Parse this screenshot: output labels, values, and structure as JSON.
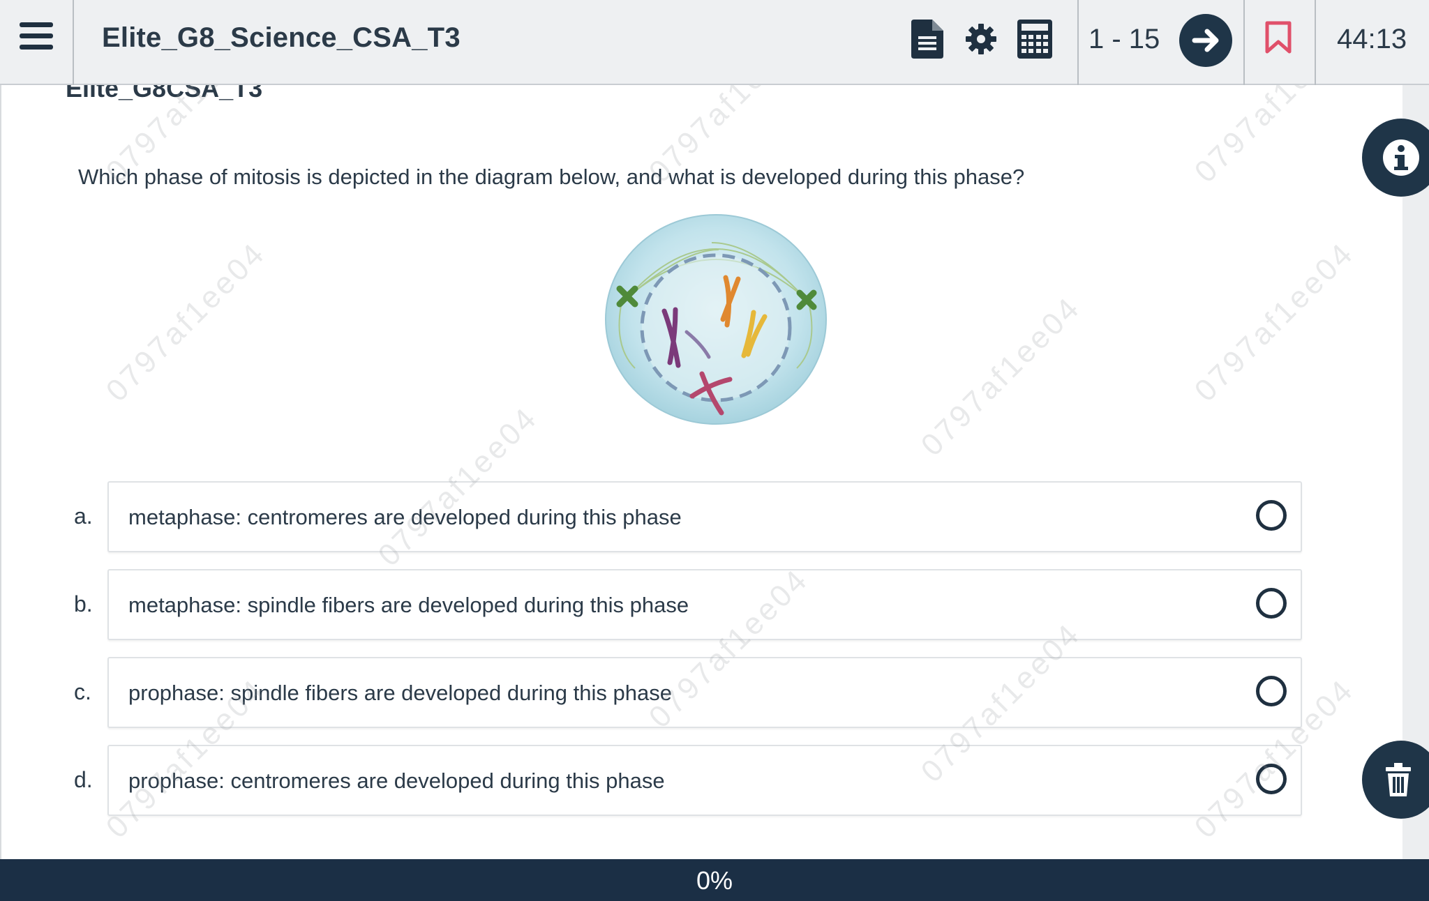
{
  "header": {
    "title": "Elite_G8_Science_CSA_T3",
    "question_range": "1 - 15",
    "timer": "44:13"
  },
  "content": {
    "sub_title": "Elite_G8CSA_T3",
    "question": "Which phase of mitosis is depicted in the diagram below, and what is developed during this phase?",
    "choices": [
      {
        "letter": "a.",
        "text": "metaphase: centromeres are developed during this phase"
      },
      {
        "letter": "b.",
        "text": "metaphase: spindle fibers are developed during this phase"
      },
      {
        "letter": "c.",
        "text": "prophase: spindle fibers are developed during this phase"
      },
      {
        "letter": "d.",
        "text": "prophase: centromeres are developed during this phase"
      }
    ]
  },
  "watermark": "0797af1ee04",
  "progress": {
    "label": "0%",
    "value": 0
  },
  "icons": {
    "menu": "hamburger-menu-icon",
    "document": "document-icon",
    "settings": "gear-icon",
    "calculator": "calculator-icon",
    "next": "arrow-right-icon",
    "bookmark": "bookmark-icon",
    "info": "info-icon",
    "delete": "trash-icon"
  },
  "colors": {
    "accent": "#1f3548",
    "bookmark": "#e0506a",
    "bottom_bar": "#1b2f45"
  }
}
